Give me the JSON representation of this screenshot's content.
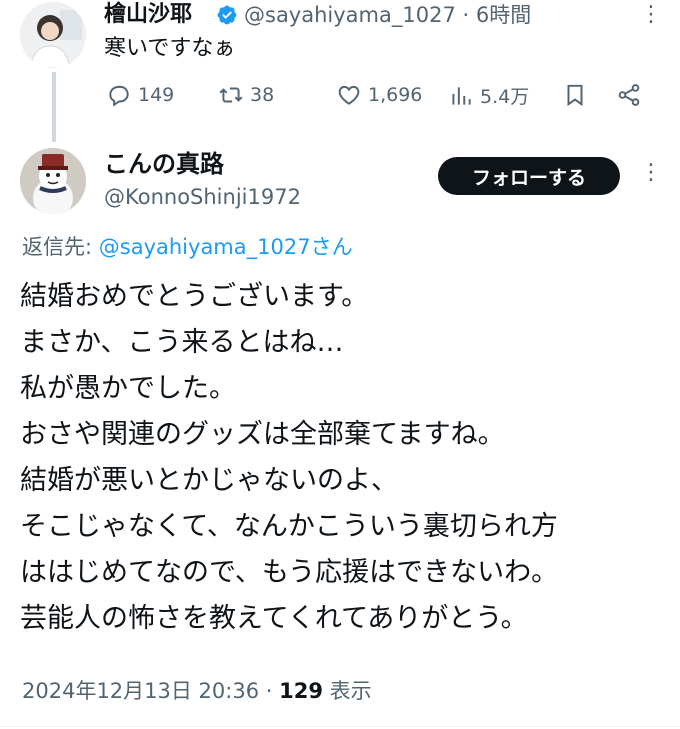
{
  "parent_tweet": {
    "author_name": "檜山沙耶",
    "handle": "@sayahiyama_1027",
    "separator": "·",
    "time": "6時間",
    "text": "寒いですなぁ",
    "actions": {
      "replies": "149",
      "retweets": "38",
      "likes": "1,696",
      "views": "5.4万"
    },
    "icons": [
      "verified-icon",
      "reply-icon",
      "retweet-icon",
      "like-icon",
      "views-icon",
      "bookmark-icon",
      "share-icon",
      "more-icon"
    ]
  },
  "reply_tweet": {
    "author_name": "こんの真路",
    "handle": "@KonnoShinji1972",
    "follow_label": "フォローする",
    "reply_to_label": "返信先: ",
    "reply_to_handle": "@sayahiyama_1027さん",
    "lines": [
      "結婚おめでとうございます。",
      "まさか、こう来るとはね…",
      "私が愚かでした。",
      "おさや関連のグッズは全部棄てますね。",
      "結婚が悪いとかじゃないのよ、",
      "そこじゃなくて、なんかこういう裏切られ方",
      "ははじめてなので、もう応援はできないわ。",
      "芸能人の怖さを教えてくれてありがとう。"
    ],
    "timestamp": "2024年12月13日 20:36",
    "meta_separator": " · ",
    "view_count": "129",
    "view_label": " 表示"
  },
  "colors": {
    "text": "#0f1419",
    "secondary": "#536471",
    "link": "#1d9bf0",
    "verified": "#1d9bf0",
    "thread_line": "#cfd9de"
  }
}
